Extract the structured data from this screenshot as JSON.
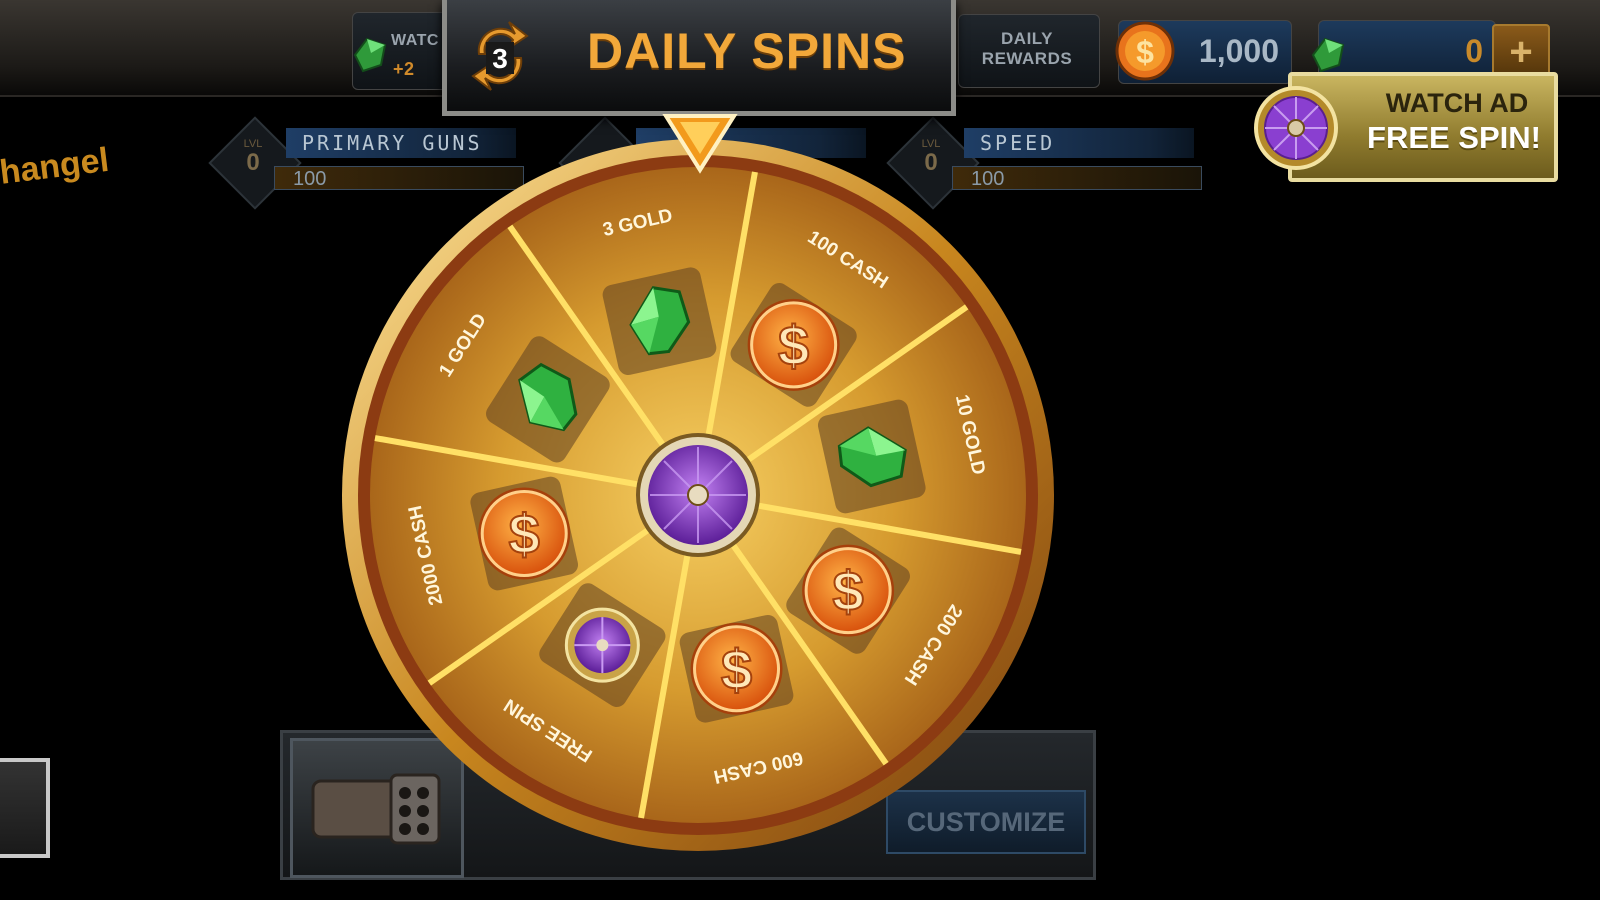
{
  "header": {
    "watch_label": "WATC",
    "watch_bonus": "+2",
    "daily_rewards_label": "DAILY REWARDS",
    "cash_amount": "1,000",
    "gold_amount": "0",
    "add_symbol": "+"
  },
  "title": {
    "text": "DAILY SPINS",
    "spins_count": "3"
  },
  "stats": [
    {
      "name": "PRIMARY GUNS",
      "level_label": "LVL",
      "level": "0",
      "value": "100"
    },
    {
      "name": "SPEED",
      "level_label": "LVL",
      "level": "0",
      "value": "100"
    }
  ],
  "watch_ad": {
    "line1": "WATCH AD",
    "line2": "FREE SPIN!"
  },
  "player_name": "hangel",
  "wheel": {
    "segments": [
      {
        "label": "1 GOLD",
        "reward": "gold-gem-icon"
      },
      {
        "label": "3 GOLD",
        "reward": "gold-gem-icon"
      },
      {
        "label": "100 CASH",
        "reward": "cash-coin-icon"
      },
      {
        "label": "10 GOLD",
        "reward": "gold-gem-icon"
      },
      {
        "label": "200 CASH",
        "reward": "cash-coin-icon"
      },
      {
        "label": "600 CASH",
        "reward": "cash-coin-icon"
      },
      {
        "label": "FREE SPIN",
        "reward": "spin-wheel-icon"
      },
      {
        "label": "2000 CASH",
        "reward": "cash-coin-icon"
      }
    ]
  },
  "bottom": {
    "customize_label": "CUSTOMIZE"
  },
  "colors": {
    "gold": "#f2a83a",
    "wheel_face": "#d49a2c",
    "gem_green": "#3ec24a",
    "spin_purple": "#8a3fd0"
  }
}
